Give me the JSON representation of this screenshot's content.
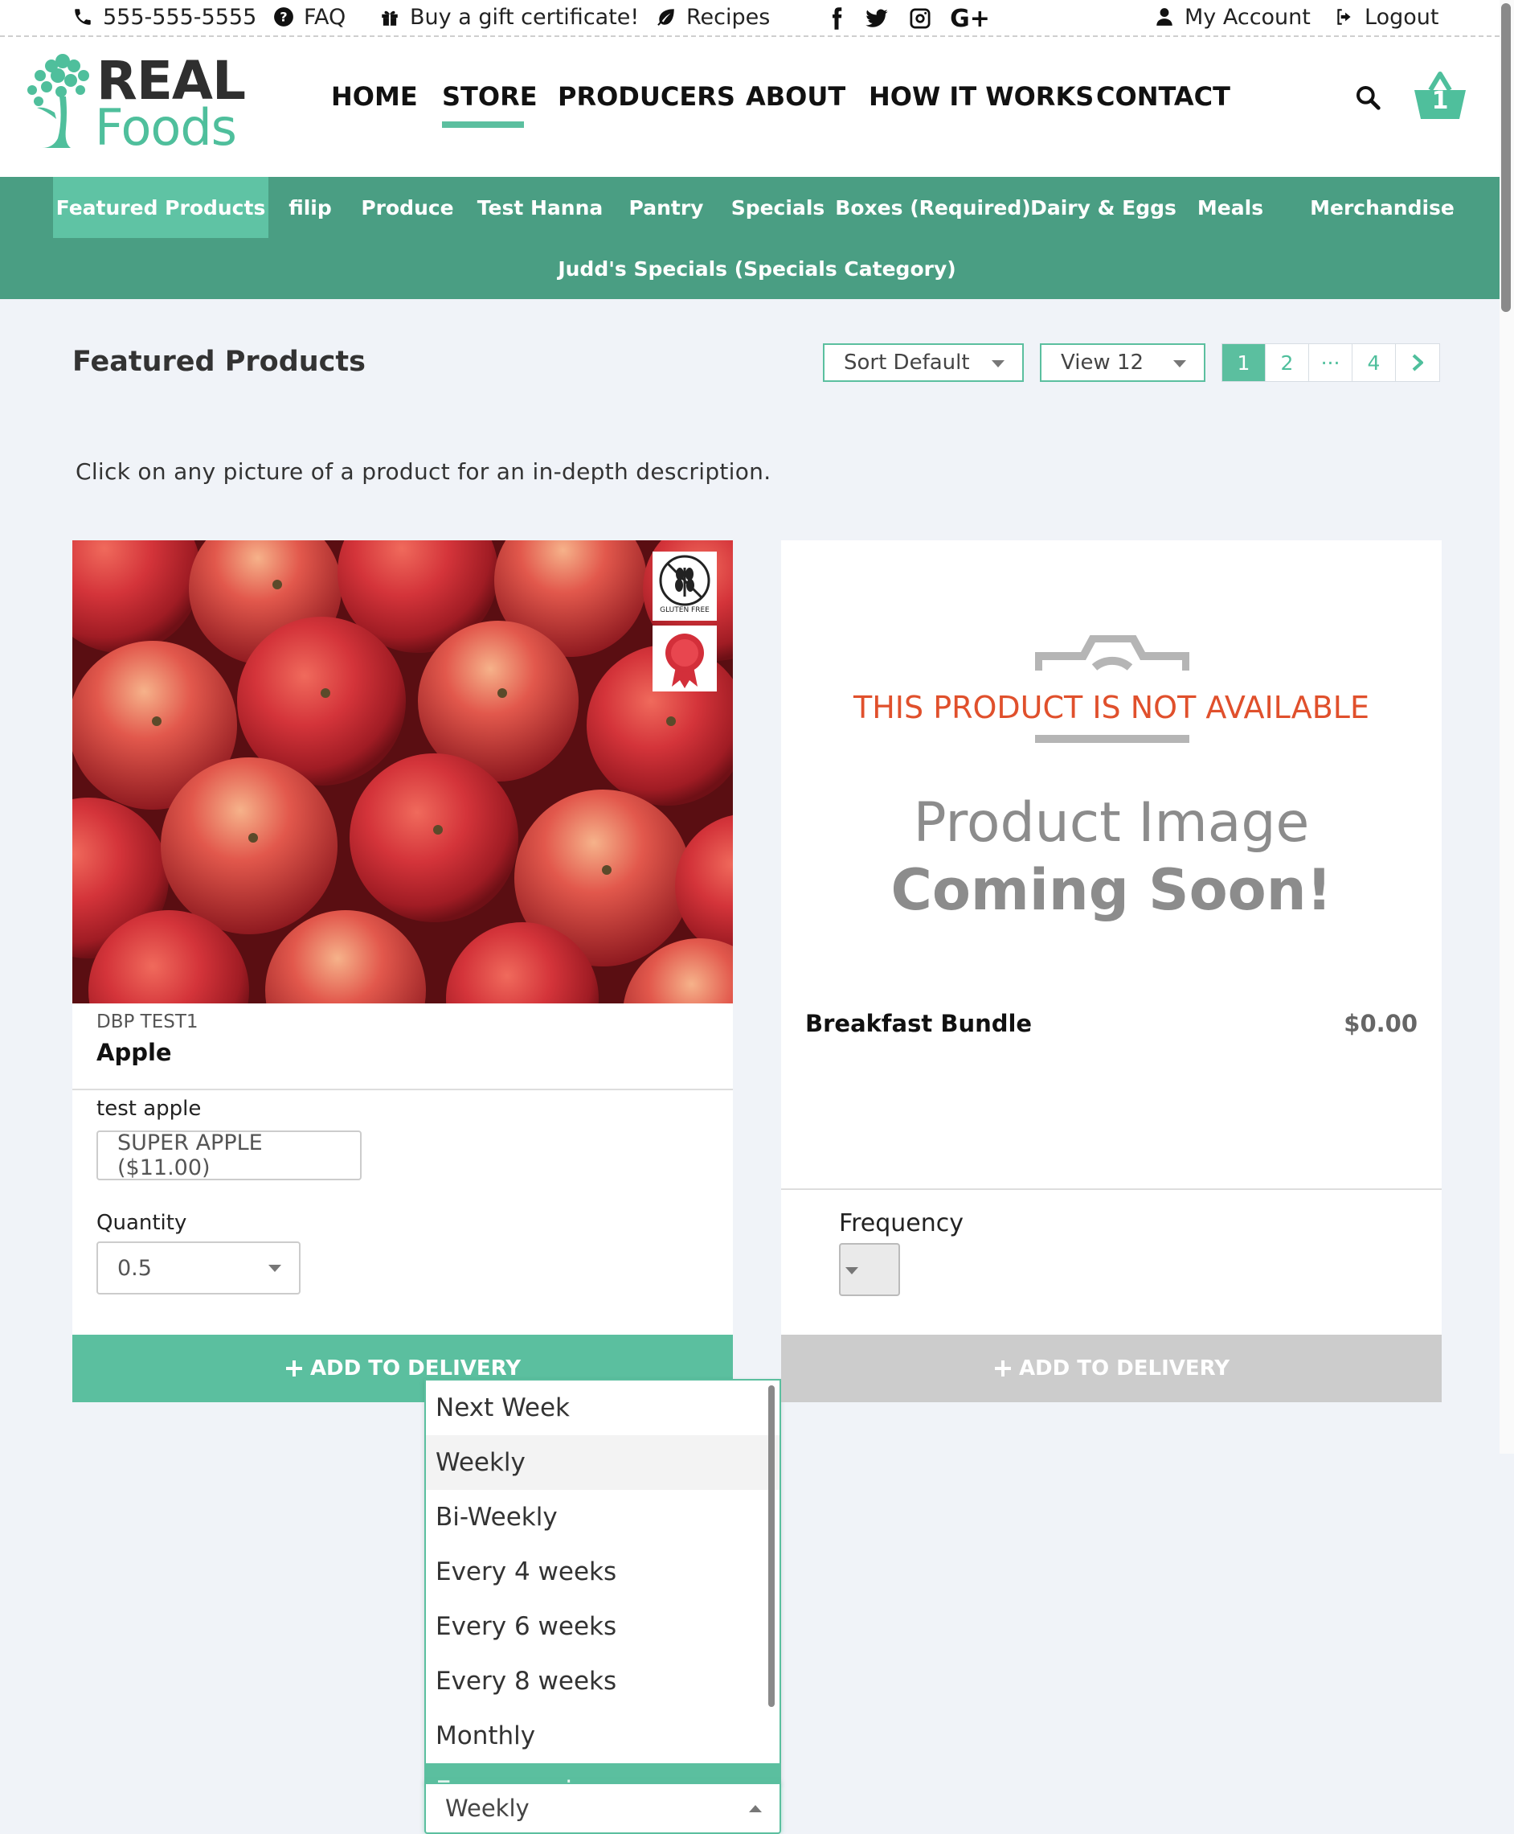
{
  "topbar": {
    "phone": "555-555-5555",
    "faq": "FAQ",
    "gift": "Buy a gift certificate!",
    "recipes": "Recipes",
    "social": [
      "facebook-icon",
      "twitter-icon",
      "instagram-icon",
      "google-plus-icon"
    ],
    "google_plus": "G+",
    "my_account": "My Account",
    "logout": "Logout"
  },
  "logo": {
    "word1": "REAL",
    "word2": "Foods"
  },
  "nav": {
    "items": [
      "HOME",
      "STORE",
      "PRODUCERS",
      "ABOUT",
      "HOW IT WORKS",
      "CONTACT"
    ],
    "active": "STORE"
  },
  "cart": {
    "count": "1"
  },
  "categories": {
    "items": [
      "Featured Products",
      "filip",
      "Produce",
      "Test Hanna",
      "Pantry",
      "Specials",
      "Boxes (Required)",
      "Dairy & Eggs",
      "Meals",
      "Merchandise",
      "Judd's Specials (Specials Category)"
    ],
    "active": "Featured Products"
  },
  "toolbar": {
    "title": "Featured Products",
    "sort_value": "Sort Default",
    "view_value": "View 12",
    "pages": [
      "1",
      "2",
      "···",
      "4"
    ],
    "active_page": "1"
  },
  "intro": "Click on any picture of a product for an in-depth description.",
  "product1": {
    "sku": "DBP TEST1",
    "name": "Apple",
    "variant_label": "test apple",
    "variant_value": "SUPER APPLE ($11.00)",
    "quantity_label": "Quantity",
    "quantity_value": "0.5",
    "badge_text": "GLUTEN FREE",
    "frequency_options": [
      "Next Week",
      "Weekly",
      "Bi-Weekly",
      "Every 4 weeks",
      "Every 6 weeks",
      "Every 8 weeks",
      "Monthly",
      "Every week"
    ],
    "frequency_hover": "Weekly",
    "frequency_value": "Weekly",
    "add_label": "ADD TO DELIVERY"
  },
  "product2": {
    "not_available": "THIS PRODUCT IS NOT AVAILABLE",
    "placeholder_line1": "Product Image",
    "placeholder_line2": "Coming Soon!",
    "name": "Breakfast Bundle",
    "price": "$0.00",
    "frequency_label": "Frequency",
    "add_label": "ADD TO DELIVERY"
  },
  "colors": {
    "brand_green": "#5bbf9f",
    "category_bar": "#4a9e83",
    "alert_red": "#e0502c",
    "disabled_gray": "#cccccc"
  }
}
